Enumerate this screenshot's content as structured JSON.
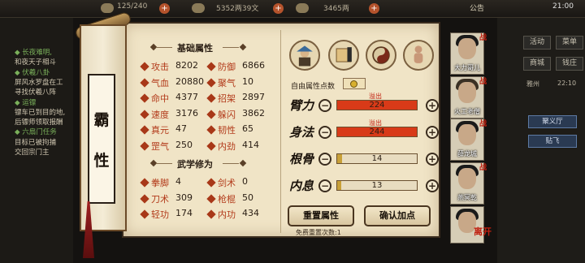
{
  "hud": {
    "stamina": "125/240",
    "coins": "5352两39文",
    "silver": "3465两",
    "notice": "公告",
    "time": "21:00"
  },
  "quests": [
    {
      "text": "◆ 长夜难明,",
      "type": "title"
    },
    {
      "text": "和夜天子相斗",
      "type": "sub"
    },
    {
      "text": "◆ 伏羲八卦",
      "type": "title"
    },
    {
      "text": "屏风水罗盘在工",
      "type": "sub"
    },
    {
      "text": "寻找伏羲八阵",
      "type": "sub"
    },
    {
      "text": "◆ 运镖",
      "type": "title"
    },
    {
      "text": "镖车已到目的地,",
      "type": "sub"
    },
    {
      "text": "后镖师领取报酬",
      "type": "sub"
    },
    {
      "text": "◆ 六扇门任务",
      "type": "title"
    },
    {
      "text": "目标已被拘捕",
      "type": "sub"
    },
    {
      "text": "交回宗门主",
      "type": "sub"
    }
  ],
  "scroll": {
    "chars": [
      "霸",
      "性"
    ]
  },
  "basic": {
    "header": "基础属性",
    "stats": [
      {
        "name": "攻击",
        "value": "8202"
      },
      {
        "name": "防御",
        "value": "6866"
      },
      {
        "name": "气血",
        "value": "20880"
      },
      {
        "name": "聚气",
        "value": "10"
      },
      {
        "name": "命中",
        "value": "4377"
      },
      {
        "name": "招架",
        "value": "2897"
      },
      {
        "name": "速度",
        "value": "3176"
      },
      {
        "name": "躲闪",
        "value": "3862"
      },
      {
        "name": "真元",
        "value": "47"
      },
      {
        "name": "韧性",
        "value": "65"
      },
      {
        "name": "罡气",
        "value": "250"
      },
      {
        "name": "内劲",
        "value": "414"
      }
    ]
  },
  "martial": {
    "header": "武学修为",
    "stats": [
      {
        "name": "拳脚",
        "value": "4"
      },
      {
        "name": "剑术",
        "value": "0"
      },
      {
        "name": "刀术",
        "value": "309"
      },
      {
        "name": "枪棍",
        "value": "50"
      },
      {
        "name": "轻功",
        "value": "174"
      },
      {
        "name": "内功",
        "value": "434"
      }
    ]
  },
  "free_points": {
    "label": "自由属性点数"
  },
  "attributes": [
    {
      "name": "臂力",
      "value": "224",
      "overflow": "溢出",
      "fill": 1.0,
      "color": "#d83a18"
    },
    {
      "name": "身法",
      "value": "244",
      "overflow": "溢出",
      "fill": 1.0,
      "color": "#d83a18"
    },
    {
      "name": "根骨",
      "value": "14",
      "overflow": "",
      "fill": 0.06,
      "color": "#c8a038"
    },
    {
      "name": "内息",
      "value": "13",
      "overflow": "",
      "fill": 0.05,
      "color": "#c8a038"
    }
  ],
  "buttons": {
    "reset": "重置属性",
    "confirm": "确认加点",
    "reset_note": "免费重置次数:1"
  },
  "right_menu": {
    "buttons": [
      "活动",
      "菜单",
      "商城",
      "钱庄"
    ],
    "area_label": "雅州",
    "area_time": "22:10",
    "tasks": [
      "聚义厅",
      "贴飞"
    ]
  },
  "characters": [
    {
      "name": "大力哥儿"
    },
    {
      "name": "火工老僧"
    },
    {
      "name": "薛龙城"
    },
    {
      "name": "燕冥乾"
    },
    {
      "name": "离开"
    }
  ],
  "colors": {
    "parchment": "#f0e4c6",
    "stat_name": "#b23a1a",
    "overflow": "#c02010"
  }
}
